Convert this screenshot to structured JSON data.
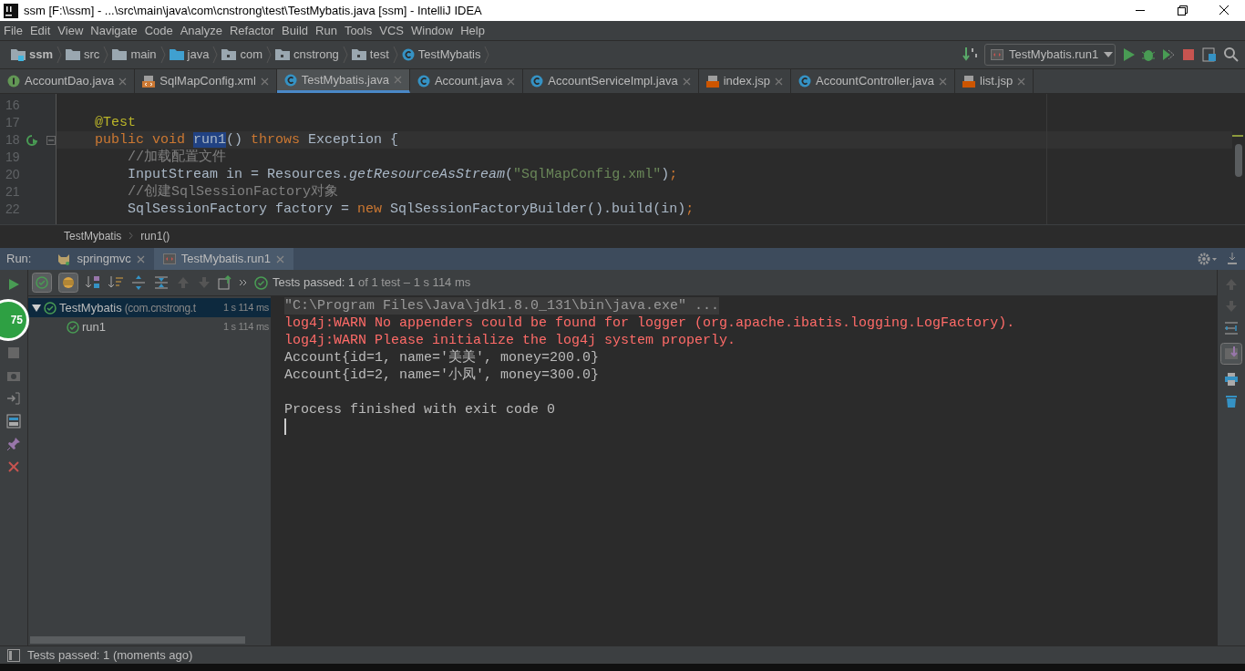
{
  "window": {
    "title": "ssm [F:\\\\ssm] - ...\\src\\main\\java\\com\\cnstrong\\test\\TestMybatis.java [ssm] - IntelliJ IDEA"
  },
  "menu": [
    "File",
    "Edit",
    "View",
    "Navigate",
    "Code",
    "Analyze",
    "Refactor",
    "Build",
    "Run",
    "Tools",
    "VCS",
    "Window",
    "Help"
  ],
  "navigation": [
    {
      "label": "ssm",
      "kind": "module"
    },
    {
      "label": "src",
      "kind": "folder"
    },
    {
      "label": "main",
      "kind": "folder"
    },
    {
      "label": "java",
      "kind": "source"
    },
    {
      "label": "com",
      "kind": "package"
    },
    {
      "label": "cnstrong",
      "kind": "package"
    },
    {
      "label": "test",
      "kind": "package"
    },
    {
      "label": "TestMybatis",
      "kind": "class"
    }
  ],
  "run_configuration": "TestMybatis.run1",
  "tabs": [
    {
      "label": "AccountDao.java",
      "kind": "interface",
      "selected": false
    },
    {
      "label": "SqlMapConfig.xml",
      "kind": "xml",
      "selected": false
    },
    {
      "label": "TestMybatis.java",
      "kind": "class",
      "selected": true
    },
    {
      "label": "Account.java",
      "kind": "class",
      "selected": false
    },
    {
      "label": "AccountServiceImpl.java",
      "kind": "class",
      "selected": false
    },
    {
      "label": "index.jsp",
      "kind": "jsp",
      "selected": false
    },
    {
      "label": "AccountController.java",
      "kind": "class",
      "selected": false
    },
    {
      "label": "list.jsp",
      "kind": "jsp",
      "selected": false
    }
  ],
  "editor": {
    "lines": [
      {
        "number": "16"
      },
      {
        "number": "17",
        "tokens": [
          {
            "text": "    @Test",
            "kind": "annotation"
          }
        ]
      },
      {
        "number": "18",
        "current": true,
        "tokens": [
          {
            "text": "    public void ",
            "kind": "keyword"
          },
          {
            "text": "run1",
            "kind": "selected"
          },
          {
            "text": "() "
          },
          {
            "text": "throws ",
            "kind": "keyword"
          },
          {
            "text": "Exception {"
          }
        ]
      },
      {
        "number": "19",
        "tokens": [
          {
            "text": "        //加载配置文件",
            "kind": "comment"
          }
        ]
      },
      {
        "number": "20",
        "tokens": [
          {
            "text": "        InputStream in = Resources."
          },
          {
            "text": "getResourceAsStream",
            "kind": "italic"
          },
          {
            "text": "("
          },
          {
            "text": "\"SqlMapConfig.xml\"",
            "kind": "string"
          },
          {
            "text": ")"
          },
          {
            "text": ";",
            "kind": "keyword"
          }
        ]
      },
      {
        "number": "21",
        "tokens": [
          {
            "text": "        //创建SqlSessionFactory对象",
            "kind": "comment"
          }
        ]
      },
      {
        "number": "22",
        "tokens": [
          {
            "text": "        SqlSessionFactory factory = "
          },
          {
            "text": "new ",
            "kind": "keyword"
          },
          {
            "text": "SqlSessionFactoryBuilder().build(in)"
          },
          {
            "text": ";",
            "kind": "keyword"
          }
        ]
      }
    ],
    "breadcrumb": [
      "TestMybatis",
      "run1()"
    ]
  },
  "run": {
    "label": "Run:",
    "tabs": [
      {
        "label": "springmvc",
        "kind": "server",
        "selected": false
      },
      {
        "label": "TestMybatis.run1",
        "kind": "test",
        "selected": true
      }
    ],
    "status": {
      "prefix": "Tests passed:",
      "count": "1",
      "detail": "of 1 test – 1 s 114 ms"
    },
    "tree": [
      {
        "name": "TestMybatis",
        "detail": "(com.cnstrong.t",
        "time": "1 s 114 ms",
        "expanded": true,
        "children": [
          {
            "name": "run1",
            "time": "1 s 114 ms"
          }
        ]
      }
    ],
    "console": [
      {
        "text": "\"C:\\Program Files\\Java\\jdk1.8.0_131\\bin\\java.exe\" ...",
        "kind": "command"
      },
      {
        "text": "log4j:WARN No appenders could be found for logger (org.apache.ibatis.logging.LogFactory).",
        "kind": "error"
      },
      {
        "text": "log4j:WARN Please initialize the log4j system properly.",
        "kind": "error"
      },
      {
        "text": "Account{id=1, name='美美', money=200.0}",
        "kind": "output"
      },
      {
        "text": "Account{id=2, name='小凤', money=300.0}",
        "kind": "output"
      },
      {
        "kind": "blank"
      },
      {
        "text": "Process finished with exit code 0",
        "kind": "output"
      }
    ]
  },
  "overlay_badge": "75",
  "status_bar": "Tests passed: 1 (moments ago)"
}
